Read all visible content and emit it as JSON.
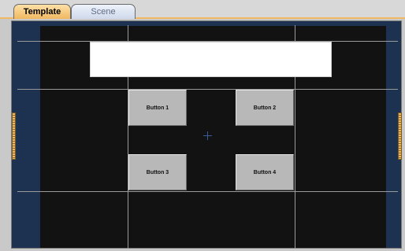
{
  "tabs": [
    {
      "label": "Template",
      "active": true
    },
    {
      "label": "Scene",
      "active": false
    }
  ],
  "buttons": [
    {
      "label": "Button 1"
    },
    {
      "label": "Button 2"
    },
    {
      "label": "Button 3"
    },
    {
      "label": "Button 4"
    }
  ],
  "colors": {
    "active_tab": "#f0b860",
    "side_panel": "#1d3150",
    "canvas": "#121212",
    "button": "#b8b8b8",
    "grid_line": "#9a9a9a"
  }
}
